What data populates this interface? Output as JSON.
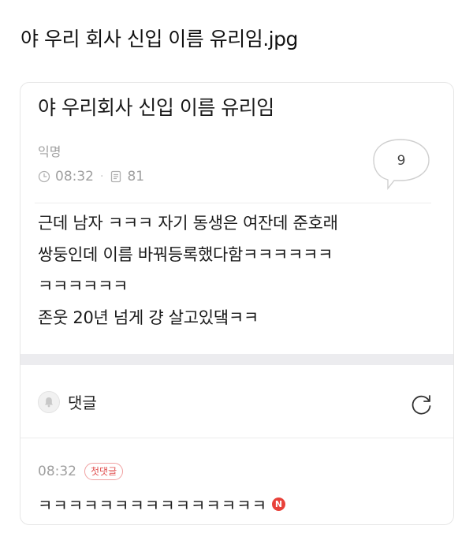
{
  "page": {
    "title": "야 우리 회사 신입 이름 유리임.jpg"
  },
  "post": {
    "title": "야 우리회사 신입 이름 유리임",
    "author": "익명",
    "time": "08:32",
    "views": "81",
    "comment_count": "9",
    "body_lines": [
      "근데 남자 ㅋㅋㅋ 자기 동생은 여잔데 준호래",
      "쌍둥인데 이름 바꿔등록했다함ㅋㅋㅋㅋㅋㅋ",
      "ㅋㅋㅋㅋㅋㅋ",
      "존웃 20년 넘게 걍 살고있댘ㅋㅋ"
    ]
  },
  "comments_section": {
    "label": "댓글"
  },
  "comments": [
    {
      "time": "08:32",
      "badge": "첫댓글",
      "text": "ㅋㅋㅋㅋㅋㅋㅋㅋㅋㅋㅋㅋㅋㅋㅋ",
      "new_badge": "N"
    }
  ],
  "colors": {
    "accent_red": "#e8413a",
    "muted_text": "#a0a0a0",
    "band": "#ececef"
  },
  "icons": {
    "clock": "clock-icon",
    "views": "document-icon",
    "comment_bubble": "speech-bubble-icon",
    "bell": "bell-icon",
    "refresh": "refresh-icon"
  }
}
